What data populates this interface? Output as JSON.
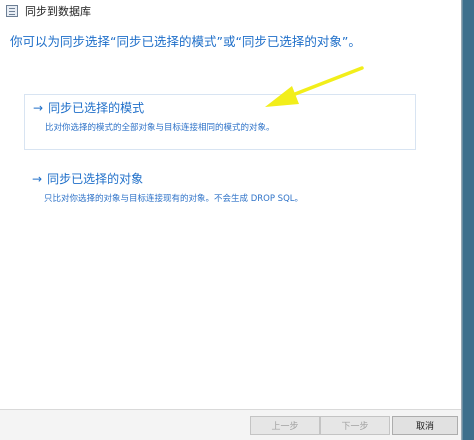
{
  "window": {
    "title": "同步到数据库"
  },
  "heading": "你可以为同步选择“同步已选择的模式”或“同步已选择的对象”。",
  "options": [
    {
      "title": "同步已选择的模式",
      "description": "比对你选择的模式的全部对象与目标连接相同的模式的对象。"
    },
    {
      "title": "同步已选择的对象",
      "description": "只比对你选择的对象与目标连接现有的对象。不会生成 DROP SQL。"
    }
  ],
  "footer": {
    "prev_label": "上一步",
    "next_label": "下一步",
    "cancel_label": "取消"
  },
  "colors": {
    "accent": "#1f6fc9",
    "annotation": "#f2ee1a"
  }
}
